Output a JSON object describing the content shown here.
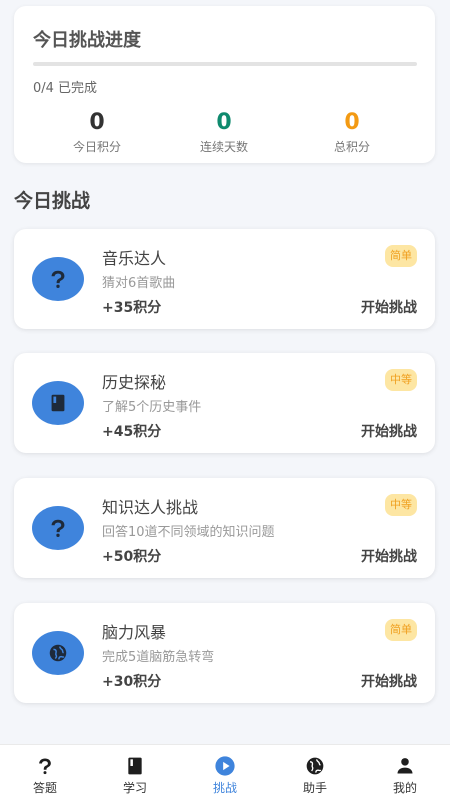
{
  "progress": {
    "title": "今日挑战进度",
    "status_text": "0/4 已完成",
    "completed_fraction": 0,
    "stats": [
      {
        "value": "0",
        "label": "今日积分",
        "color": "#333333"
      },
      {
        "value": "0",
        "label": "连续天数",
        "color": "#0f8a6e"
      },
      {
        "value": "0",
        "label": "总积分",
        "color": "#f39a13"
      }
    ]
  },
  "section_title": "今日挑战",
  "challenges": [
    {
      "title": "音乐达人",
      "desc": "猜对6首歌曲",
      "points": "+35积分",
      "action": "开始挑战",
      "badge": "简单",
      "icon": "question-icon"
    },
    {
      "title": "历史探秘",
      "desc": "了解5个历史事件",
      "points": "+45积分",
      "action": "开始挑战",
      "badge": "中等",
      "icon": "book-icon"
    },
    {
      "title": "知识达人挑战",
      "desc": "回答10道不同领域的知识问题",
      "points": "+50积分",
      "action": "开始挑战",
      "badge": "中等",
      "icon": "question-icon"
    },
    {
      "title": "脑力风暴",
      "desc": "完成5道脑筋急转弯",
      "points": "+30积分",
      "action": "开始挑战",
      "badge": "简单",
      "icon": "globe-icon"
    }
  ],
  "tabs": [
    {
      "label": "答题",
      "icon": "question-icon"
    },
    {
      "label": "学习",
      "icon": "book-icon"
    },
    {
      "label": "挑战",
      "icon": "play-icon",
      "active": true
    },
    {
      "label": "助手",
      "icon": "globe-icon"
    },
    {
      "label": "我的",
      "icon": "person-icon"
    }
  ],
  "colors": {
    "accent": "#3f84dc",
    "badge_bg": "#fde6a3",
    "badge_text": "#f0a020"
  }
}
